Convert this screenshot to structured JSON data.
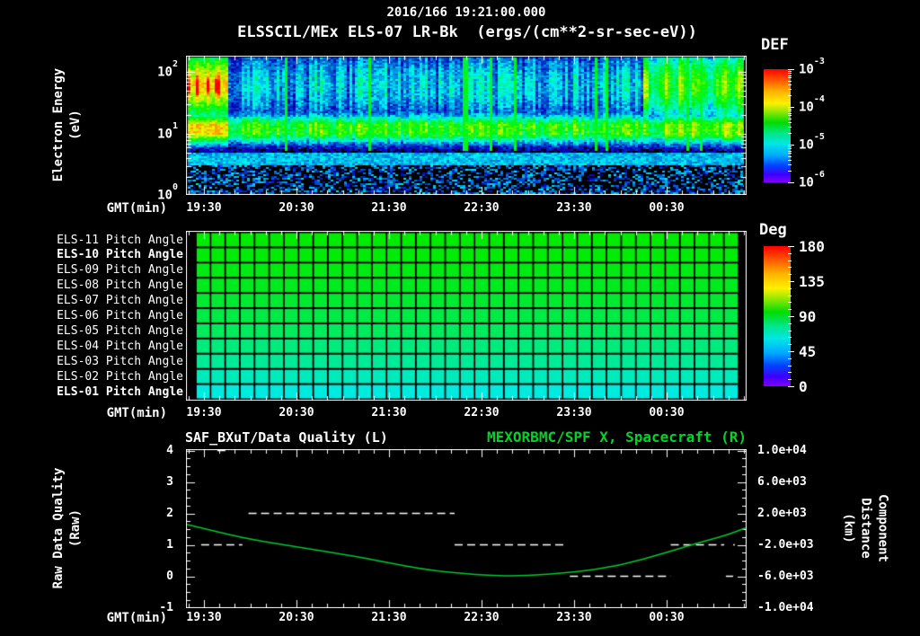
{
  "colors": {
    "background": "#000000",
    "text": "#ffffff",
    "title_green": "#00d428",
    "curve_green": "#00c832"
  },
  "header": {
    "date_time": "2016/166 19:21:00.000",
    "plot_title": "ELSSCIL/MEx ELS-07 LR-Bk  (ergs/(cm**2-sr-sec-eV))"
  },
  "time_axis": {
    "label": "GMT(min)",
    "ticks": [
      "19:30",
      "20:30",
      "21:30",
      "22:30",
      "23:30",
      "00:30"
    ]
  },
  "energy_axis": {
    "label_line1": "Electron Energy",
    "label_line2": "(eV)",
    "ticks": [
      {
        "base": "10",
        "exp": "2"
      },
      {
        "base": "10",
        "exp": "1"
      },
      {
        "base": "10",
        "exp": "0"
      }
    ]
  },
  "def_colorbar": {
    "title": "DEF",
    "ticks": [
      {
        "base": "10",
        "exp": "-3"
      },
      {
        "base": "10",
        "exp": "-4"
      },
      {
        "base": "10",
        "exp": "-5"
      },
      {
        "base": "10",
        "exp": "-6"
      }
    ]
  },
  "deg_colorbar": {
    "title": "Deg",
    "ticks": [
      "180",
      "135",
      "90",
      "45",
      "0"
    ]
  },
  "pitch_rows": [
    {
      "label": "ELS-11 Pitch Angle",
      "bold": false,
      "pitch_deg": 100
    },
    {
      "label": "ELS-10 Pitch Angle",
      "bold": true,
      "pitch_deg": 99
    },
    {
      "label": "ELS-09 Pitch Angle",
      "bold": false,
      "pitch_deg": 97
    },
    {
      "label": "ELS-08 Pitch Angle",
      "bold": false,
      "pitch_deg": 95
    },
    {
      "label": "ELS-07 Pitch Angle",
      "bold": false,
      "pitch_deg": 92
    },
    {
      "label": "ELS-06 Pitch Angle",
      "bold": false,
      "pitch_deg": 88
    },
    {
      "label": "ELS-05 Pitch Angle",
      "bold": false,
      "pitch_deg": 84
    },
    {
      "label": "ELS-04 Pitch Angle",
      "bold": false,
      "pitch_deg": 79
    },
    {
      "label": "ELS-03 Pitch Angle",
      "bold": false,
      "pitch_deg": 74
    },
    {
      "label": "ELS-02 Pitch Angle",
      "bold": false,
      "pitch_deg": 68
    },
    {
      "label": "ELS-01 Pitch Angle",
      "bold": true,
      "pitch_deg": 62
    }
  ],
  "bottom_panel": {
    "title_left": "SAF_BXuT/Data Quality (L)",
    "title_right": "MEXORBMC/SPF X, Spacecraft (R)",
    "ylabel_left_line1": "Raw Data Quality",
    "ylabel_left_line2": "(Raw)",
    "ylabel_right_line1": "Component Distance",
    "ylabel_right_line2": "(km)",
    "left_ticks": [
      "4",
      "3",
      "2",
      "1",
      "0",
      "-1"
    ],
    "right_ticks": [
      "1.0e+04",
      "6.0e+03",
      "2.0e+03",
      "-2.0e+03",
      "-6.0e+03",
      "-1.0e+04"
    ]
  },
  "chart_data": [
    {
      "type": "heatmap",
      "panel": "electron_energy_spectrogram",
      "title": "ELSSCIL/MEx ELS-07 LR-Bk (ergs/(cm**2-sr-sec-eV))",
      "xlabel": "GMT(min)",
      "x_ticks": [
        "19:30",
        "20:30",
        "21:30",
        "22:30",
        "23:30",
        "00:30"
      ],
      "x_range_time": [
        "19:21",
        "01:21"
      ],
      "ylabel": "Electron Energy (eV)",
      "y_scale": "log",
      "ylim": [
        1,
        180
      ],
      "colorbar": {
        "label": "DEF",
        "scale": "log",
        "range_low": "1e-6",
        "range_high": "1e-3"
      },
      "features": [
        "Intense flux 1e-4..1e-3 (yellow/red core) at 15-120 eV from 19:21 to ~19:45",
        "Persistent 1e-5..1e-4 (green/cyan) band near 7-25 eV across the whole interval",
        "Mottled blue/cyan 1e-6..1e-5 flux with vertical streaks at 30-180 eV mid-interval",
        "Brightening back to ~1e-4 (green) at 20-120 eV after ~00:15",
        "Near-background purple/black speckle below ~6 eV"
      ]
    },
    {
      "type": "heatmap",
      "panel": "pitch_angles",
      "rows": [
        "ELS-11 Pitch Angle",
        "ELS-10 Pitch Angle",
        "ELS-09 Pitch Angle",
        "ELS-08 Pitch Angle",
        "ELS-07 Pitch Angle",
        "ELS-06 Pitch Angle",
        "ELS-05 Pitch Angle",
        "ELS-04 Pitch Angle",
        "ELS-03 Pitch Angle",
        "ELS-02 Pitch Angle",
        "ELS-01 Pitch Angle"
      ],
      "row_values_deg": [
        100,
        99,
        97,
        95,
        92,
        88,
        84,
        79,
        74,
        68,
        62
      ],
      "x_ticks": [
        "19:30",
        "20:30",
        "21:30",
        "22:30",
        "23:30",
        "00:30"
      ],
      "colorbar": {
        "label": "Deg",
        "range": [
          0,
          180
        ]
      },
      "note": "Each anode row holds a nearly constant pitch angle over time (green ~100 deg at top grading to cyan ~60 deg at bottom); grid of ~37 time cells per row"
    },
    {
      "type": "line",
      "panel": "quality_and_spacecraft_x",
      "x_ticks": [
        "19:30",
        "20:30",
        "21:30",
        "22:30",
        "23:30",
        "00:30"
      ],
      "ylim_left": [
        -1,
        4
      ],
      "ylim_right": [
        -10000,
        10000
      ],
      "series": [
        {
          "name": "SAF_BXuT/Data Quality (L)",
          "axis": "left",
          "style": "dashed",
          "color": "#ffffff",
          "step_segments": [
            {
              "value": 1,
              "x_frac": [
                0.024,
                0.098
              ]
            },
            {
              "value": 4,
              "x_frac": [
                0.053,
                0.075
              ]
            },
            {
              "value": 2,
              "x_frac": [
                0.109,
                0.479
              ]
            },
            {
              "value": 1,
              "x_frac": [
                0.479,
                0.681
              ]
            },
            {
              "value": 0,
              "x_frac": [
                0.686,
                0.867
              ]
            },
            {
              "value": 1,
              "x_frac": [
                0.867,
                0.963
              ]
            },
            {
              "value": 0,
              "x_frac": [
                0.966,
                0.979
              ]
            },
            {
              "value": 1,
              "x_frac": [
                0.979,
                0.982
              ]
            }
          ]
        },
        {
          "name": "MEXORBMC/SPF X, Spacecraft (R)",
          "axis": "right",
          "style": "solid",
          "color": "#00c832",
          "points_x_frac": [
            0.0,
            0.053,
            0.109,
            0.197,
            0.309,
            0.421,
            0.518,
            0.598,
            0.694,
            0.774,
            0.854,
            0.918,
            0.966,
            1.0
          ],
          "points_km": [
            570,
            -340,
            -1260,
            -2290,
            -3540,
            -5140,
            -5830,
            -6000,
            -5490,
            -4690,
            -3090,
            -1710,
            -800,
            110
          ]
        }
      ]
    }
  ]
}
